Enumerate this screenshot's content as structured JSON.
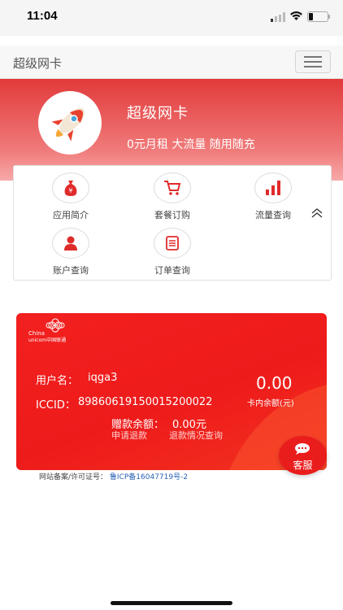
{
  "status": {
    "time": "11:04"
  },
  "navbar": {
    "title": "超级网卡"
  },
  "hero": {
    "title": "超级网卡",
    "subtitle": "0元月租 大流量 随用随充"
  },
  "menu": {
    "items": [
      {
        "label": "应用简介",
        "icon": "money-bag-icon"
      },
      {
        "label": "套餐订购",
        "icon": "shopping-cart-icon"
      },
      {
        "label": "流量查询",
        "icon": "bar-chart-icon"
      },
      {
        "label": "账户查询",
        "icon": "user-icon"
      },
      {
        "label": "订单查询",
        "icon": "order-list-icon"
      }
    ]
  },
  "card": {
    "brand_line1": "China",
    "brand_line2": "unicom中国联通",
    "username_label": "用户名：",
    "username": "iqga3",
    "iccid_label": "ICCID：",
    "iccid": "89860619150015200022",
    "gift_label": "赠款余额：",
    "gift_value": "0.00元",
    "refund_link": "申请退款",
    "refund_query_link": "退款情况查询",
    "balance": "0.00",
    "balance_label": "卡内余额(元)"
  },
  "customer_service": {
    "label": "客服"
  },
  "footer": {
    "label": "网站备案/许可证号：",
    "icp": "鲁ICP备16047719号-2"
  },
  "colors": {
    "primary": "#ee1b1b",
    "hero_top": "#e23a3a"
  }
}
